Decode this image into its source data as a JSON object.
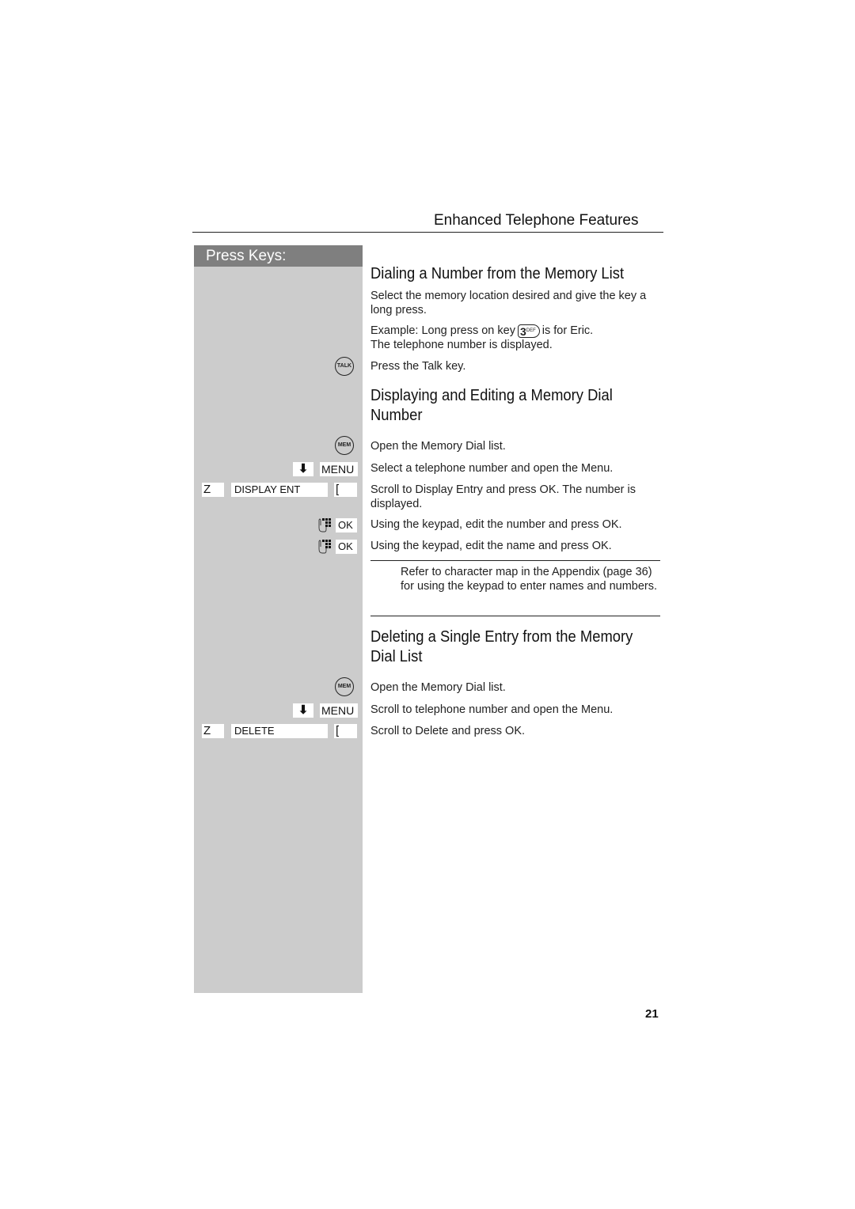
{
  "running_head": "Enhanced Telephone Features",
  "press_keys_label": "Press Keys:",
  "page_number": "21",
  "section1": {
    "title": "Dialing a Number from the Memory List",
    "p1": "Select the memory location desired and give the key a long press.",
    "p2_prefix": "Example: Long press on key",
    "p2_key_digit": "3",
    "p2_key_letters": "DEF",
    "p2_suffix": "is for Eric.",
    "p2_line2": "The telephone number is displayed.",
    "talk_key_label": "TALK",
    "p3": "Press the Talk key."
  },
  "section2": {
    "title": "Displaying and Editing a Memory Dial Number",
    "mem_key_label": "MEM",
    "step1": "Open the Memory Dial list.",
    "menu_label": "MENU",
    "step2": "Select a telephone number and open the Menu.",
    "z_label": "Z",
    "display_label": "DISPLAY ENT",
    "bracket_label": "[",
    "step3": "Scroll to Display Entry and press OK. The number is displayed.",
    "ok_label": "OK",
    "step4": "Using the keypad, edit the number and press OK.",
    "step5": "Using the keypad, edit the name and press OK.",
    "note": "Refer to character map in the Appendix (page 36) for using the keypad to enter names and numbers."
  },
  "section3": {
    "title": "Deleting a Single Entry from the Memory Dial List",
    "mem_key_label": "MEM",
    "step1": "Open the Memory Dial list.",
    "menu_label": "MENU",
    "step2": "Scroll to telephone number and open the Menu.",
    "z_label": "Z",
    "delete_label": "DELETE",
    "bracket_label": "[",
    "step3": "Scroll to Delete and press OK."
  }
}
